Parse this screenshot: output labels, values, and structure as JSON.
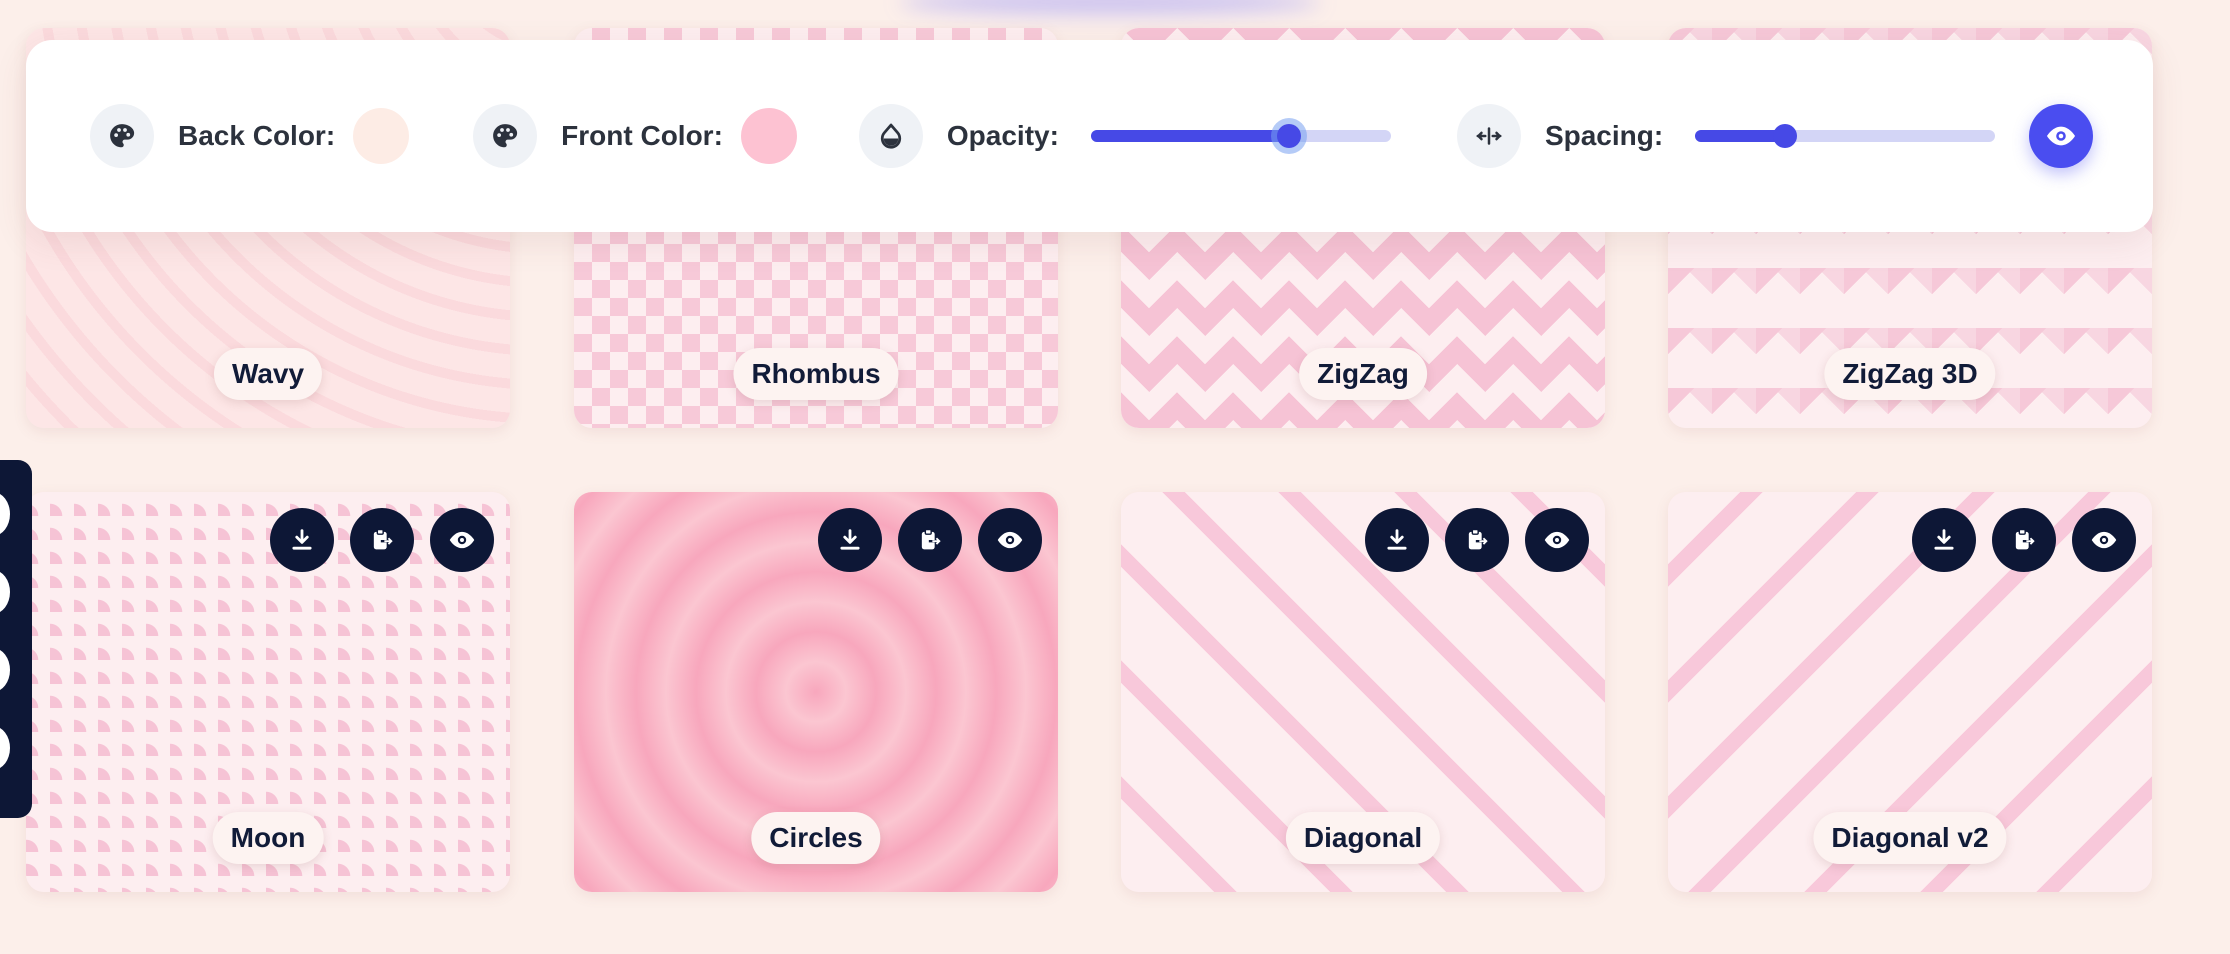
{
  "toolbar": {
    "back_color": {
      "label": "Back Color:",
      "icon": "palette-icon",
      "value": "#fdece5"
    },
    "front_color": {
      "label": "Front Color:",
      "icon": "palette-icon",
      "value": "#fdc2d2"
    },
    "opacity": {
      "label": "Opacity:",
      "icon": "droplet-icon",
      "value_percent": 66
    },
    "spacing": {
      "label": "Spacing:",
      "icon": "arrows-horizontal-icon",
      "value_percent": 30
    },
    "preview_icon": "eye-icon"
  },
  "cards": [
    {
      "label": "Wavy",
      "pattern": "wavy",
      "actions_visible": false
    },
    {
      "label": "Rhombus",
      "pattern": "rhombus",
      "actions_visible": false
    },
    {
      "label": "ZigZag",
      "pattern": "zigzag",
      "actions_visible": false
    },
    {
      "label": "ZigZag 3D",
      "pattern": "zigzag3d",
      "actions_visible": false
    },
    {
      "label": "Moon",
      "pattern": "moon",
      "actions_visible": true
    },
    {
      "label": "Circles",
      "pattern": "circles",
      "actions_visible": true
    },
    {
      "label": "Diagonal",
      "pattern": "diagonal",
      "actions_visible": true
    },
    {
      "label": "Diagonal v2",
      "pattern": "diagonal2",
      "actions_visible": true
    }
  ],
  "card_actions": [
    "download-icon",
    "clipboard-copy-icon",
    "eye-icon"
  ],
  "colors": {
    "accent": "#4a4df0",
    "dark": "#0d1736",
    "page_bg": "#fcefea"
  }
}
